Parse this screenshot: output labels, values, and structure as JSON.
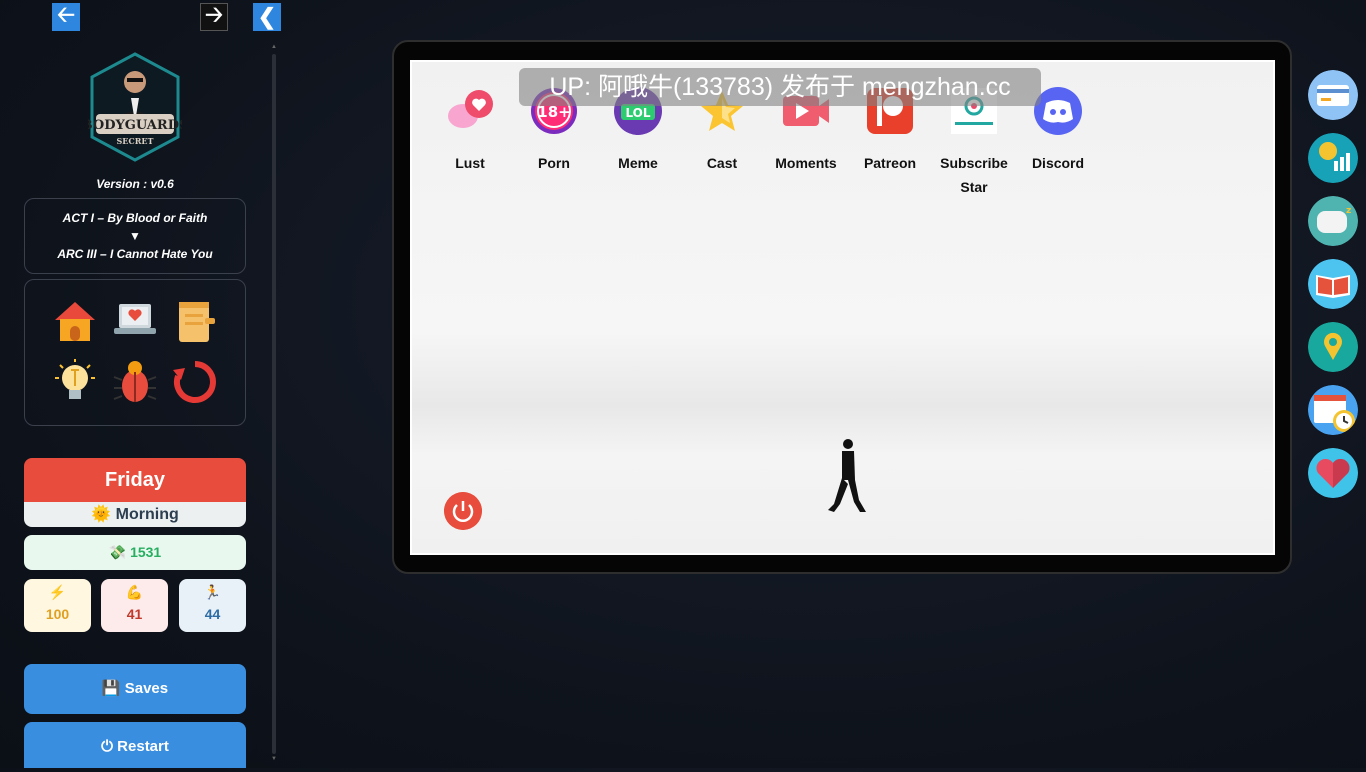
{
  "nav": {
    "back_icon": "arrow-left-icon",
    "forward_icon": "arrow-right-icon",
    "collapse_icon": "chevron-left-icon"
  },
  "sidebar": {
    "logo_text": "THE BODYGUARDS SECRET",
    "version": "Version : v0.6",
    "act": "ACT I – By Blood or Faith",
    "act_arrow": "▼",
    "arc": "ARC III – I Cannot Hate You",
    "icons": [
      "home-icon",
      "laptop-icon",
      "notebook-icon",
      "lightbulb-icon",
      "bug-icon",
      "reload-icon"
    ],
    "day": "Friday",
    "time_icon": "sun-face-icon",
    "time": "Morning",
    "money_icon": "money-icon",
    "money": "1531",
    "stats": [
      {
        "name": "energy",
        "icon": "lightning-icon",
        "value": "100",
        "color": "#e0a020"
      },
      {
        "name": "strength",
        "icon": "flexed-arm-icon",
        "value": "41",
        "color": "#c0392b"
      },
      {
        "name": "agility",
        "icon": "runner-icon",
        "value": "44",
        "color": "#2e6da4"
      }
    ],
    "saves_label": "Saves",
    "restart_label": "Restart"
  },
  "phone": {
    "watermark": "UP: 阿哦牛(133783) 发布于 mengzhan.cc",
    "apps": [
      {
        "id": "lust",
        "label": "Lust",
        "icon": "chat-heart-icon"
      },
      {
        "id": "porn",
        "label": "Porn",
        "icon": "18-plus-icon"
      },
      {
        "id": "meme",
        "label": "Meme",
        "icon": "lol-icon"
      },
      {
        "id": "cast",
        "label": "Cast",
        "icon": "star-icon"
      },
      {
        "id": "moments",
        "label": "Moments",
        "icon": "video-play-icon"
      },
      {
        "id": "patreon",
        "label": "Patreon",
        "icon": "patreon-icon"
      },
      {
        "id": "subscribestar",
        "label": "Subscribe Star",
        "icon": "subscribestar-icon"
      },
      {
        "id": "discord",
        "label": "Discord",
        "icon": "discord-icon"
      }
    ],
    "power_icon": "power-icon"
  },
  "right_icons": [
    "credit-card-icon",
    "clock-chart-icon",
    "pillow-sleep-icon",
    "book-icon",
    "map-pin-icon",
    "calendar-clock-icon",
    "heart-icon"
  ],
  "colors": {
    "accent": "#2e86de",
    "day": "#e74c3c",
    "button": "#3a8ee0",
    "money": "#27ae60"
  }
}
